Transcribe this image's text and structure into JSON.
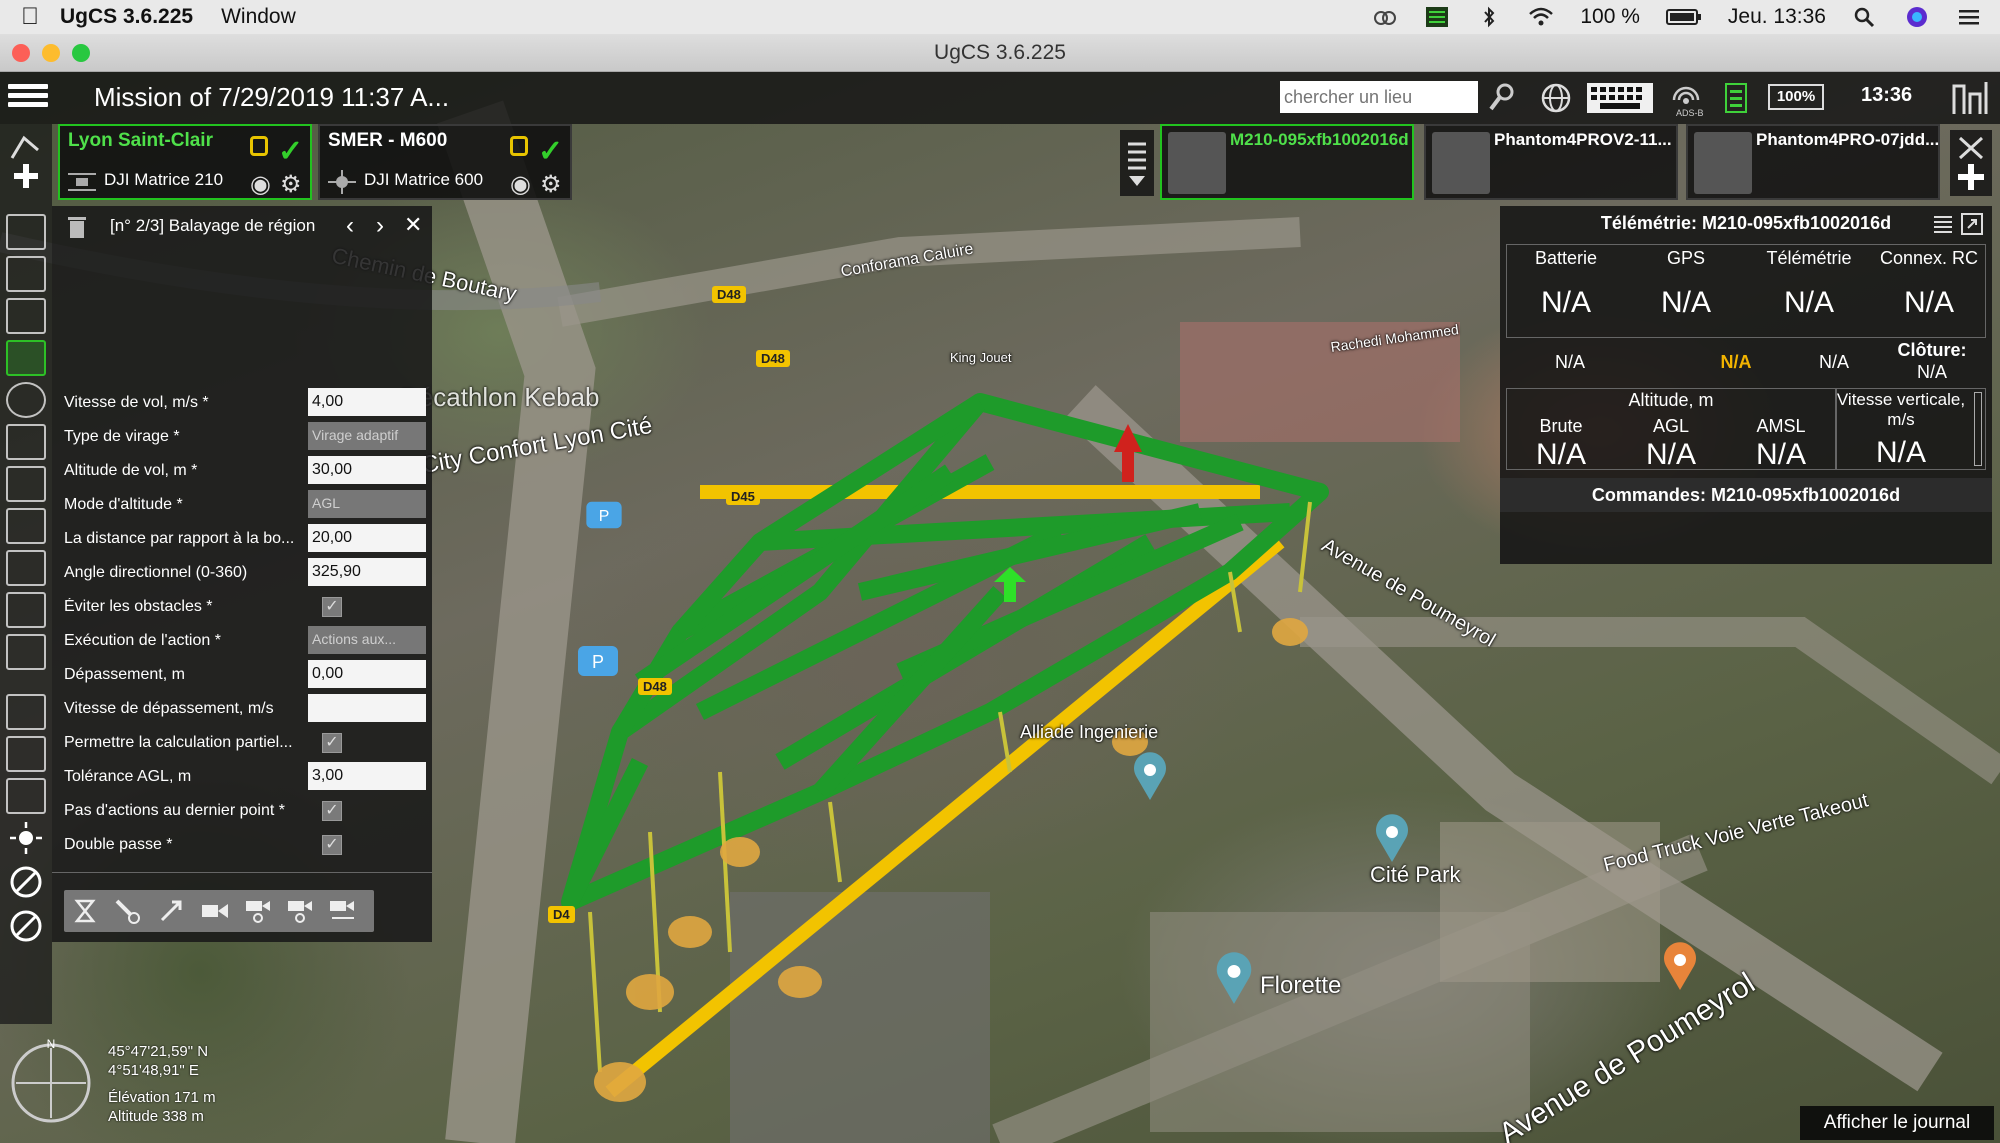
{
  "menubar": {
    "app_name": "UgCS 3.6.225",
    "menu_window": "Window",
    "battery": "100 %",
    "datetime": "Jeu. 13:36"
  },
  "window": {
    "title": "UgCS 3.6.225"
  },
  "appbar": {
    "mission_title": "Mission of 7/29/2019 11:37 A...",
    "search_placeholder": "chercher un lieu",
    "battery_percent": "100%",
    "clock": "13:36",
    "adsb_label": "ADS-B"
  },
  "vehicles": [
    {
      "name": "Lyon Saint-Clair",
      "type": "DJI Matrice 210"
    },
    {
      "name": "SMER - M600",
      "type": "DJI Matrice 600"
    }
  ],
  "drones": [
    {
      "name": "M210-095xfb1002016d"
    },
    {
      "name": "Phantom4PROV2-11..."
    },
    {
      "name": "Phantom4PRO-07jdd..."
    }
  ],
  "panel": {
    "title": "[n° 2/3] Balayage de région",
    "fields": [
      {
        "label": "Vitesse de vol, m/s *",
        "value": "4,00",
        "kind": "input"
      },
      {
        "label": "Type de virage *",
        "value": "Virage adaptif",
        "kind": "select"
      },
      {
        "label": "Altitude de vol, m *",
        "value": "30,00",
        "kind": "input"
      },
      {
        "label": "Mode d'altitude *",
        "value": "AGL",
        "kind": "select"
      },
      {
        "label": "La distance par rapport à la bo...",
        "value": "20,00",
        "kind": "input"
      },
      {
        "label": "Angle directionnel (0-360)",
        "value": "325,90",
        "kind": "input"
      },
      {
        "label": "Éviter les obstacles *",
        "value": "✓",
        "kind": "check"
      },
      {
        "label": "Exécution de l'action *",
        "value": "Actions aux...",
        "kind": "select"
      },
      {
        "label": "Dépassement, m",
        "value": "0,00",
        "kind": "input"
      },
      {
        "label": "Vitesse de dépassement, m/s",
        "value": "",
        "kind": "input"
      },
      {
        "label": "Permettre la calculation partiel...",
        "value": "✓",
        "kind": "check"
      },
      {
        "label": "Tolérance AGL, m",
        "value": "3,00",
        "kind": "input"
      },
      {
        "label": "Pas d'actions au dernier point *",
        "value": "✓",
        "kind": "check"
      },
      {
        "label": "Double passe *",
        "value": "✓",
        "kind": "check"
      }
    ]
  },
  "telemetry": {
    "title": "Télémétrie: M210-095xfb1002016d",
    "headers": [
      "Batterie",
      "GPS",
      "Télémétrie",
      "Connex. RC"
    ],
    "values": [
      "N/A",
      "N/A",
      "N/A",
      "N/A"
    ],
    "row2": [
      "N/A",
      "N/A",
      "N/A"
    ],
    "cloture_label": "Clôture:",
    "cloture_value": "N/A",
    "altitude_label": "Altitude, m",
    "alt_headers": [
      "Brute",
      "AGL",
      "AMSL"
    ],
    "alt_values": [
      "N/A",
      "N/A",
      "N/A"
    ],
    "vspeed_label": "Vitesse verticale, m/s",
    "vspeed_value": "N/A",
    "commands_title": "Commandes: M210-095xfb1002016d"
  },
  "map": {
    "labels": [
      "Chemin de Boutary",
      "City Confort Lyon Cité",
      "Conforama Caluire",
      "Avenue de Poumeyrol",
      "Cité Park",
      "Florette",
      "Food Truck Voie Verte Takeout",
      "Alliade Ingenierie",
      "King Jouet",
      "Décathlon Kebab",
      "Avenue de Poumeyrol",
      "Rachedi Mohammed"
    ],
    "road_tags": [
      "D48",
      "D48",
      "D45",
      "D48",
      "D4"
    ]
  },
  "bottom": {
    "lat": "45°47'21,59\" N",
    "lon": "4°51'48,91\" E",
    "elevation": "Élévation 171 m",
    "altitude": "Altitude 338 m",
    "journal_button": "Afficher le journal"
  },
  "colors": {
    "accent_green": "#22c31f",
    "route_green": "#1e9b2a",
    "path_yellow": "#f2c300"
  }
}
